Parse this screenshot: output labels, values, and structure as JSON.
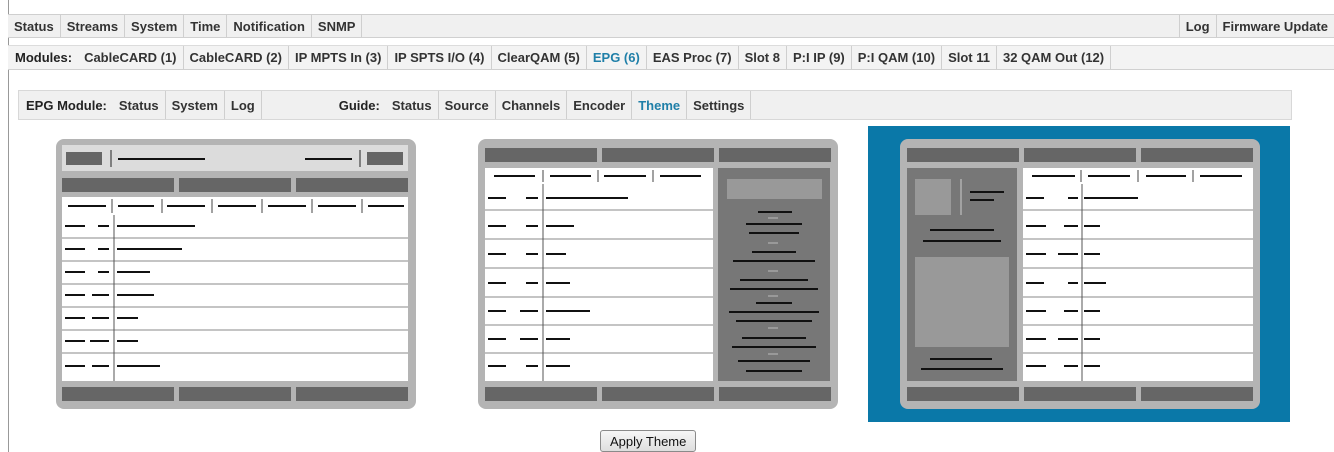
{
  "top_nav": {
    "left": [
      "Status",
      "Streams",
      "System",
      "Time",
      "Notification",
      "SNMP"
    ],
    "right": [
      "Log",
      "Firmware Update"
    ]
  },
  "modules": {
    "label": "Modules:",
    "items": [
      "CableCARD (1)",
      "CableCARD (2)",
      "IP MPTS In (3)",
      "IP SPTS I/O (4)",
      "ClearQAM (5)",
      "EPG (6)",
      "EAS Proc (7)",
      "Slot 8",
      "P:I IP (9)",
      "P:I QAM (10)",
      "Slot 11",
      "32 QAM Out (12)"
    ],
    "active": "EPG (6)"
  },
  "epg_module": {
    "label": "EPG Module:",
    "items": [
      "Status",
      "System",
      "Log"
    ]
  },
  "guide": {
    "label": "Guide:",
    "items": [
      "Status",
      "Source",
      "Channels",
      "Encoder",
      "Theme",
      "Settings"
    ],
    "active": "Theme"
  },
  "themes": {
    "count": 3,
    "selected": 3
  },
  "apply_label": "Apply Theme",
  "colors": {
    "accent": "#1f7fa8",
    "selection": "#0a78a8",
    "panel_bg": "#b4b4b4",
    "bar_dark": "#666666"
  }
}
